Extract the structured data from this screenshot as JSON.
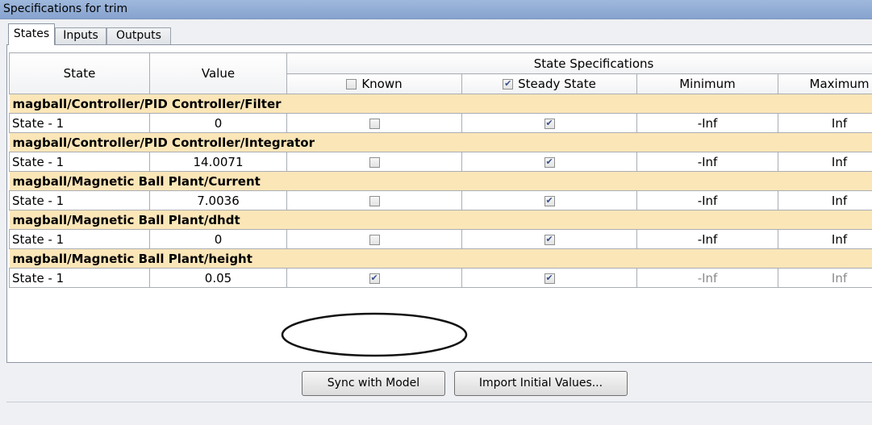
{
  "window": {
    "title": "Specifications for trim"
  },
  "tabs": [
    {
      "label": "States",
      "active": true
    },
    {
      "label": "Inputs",
      "active": false
    },
    {
      "label": "Outputs",
      "active": false
    }
  ],
  "table": {
    "col_state": "State",
    "col_value": "Value",
    "col_group": "State Specifications",
    "col_known": "Known",
    "col_steady": "Steady State",
    "col_min": "Minimum",
    "col_max": "Maximum",
    "header_known_checked": false,
    "header_steady_checked": true,
    "groups": [
      {
        "name": "magball/Controller/PID Controller/Filter",
        "row": {
          "state": "State - 1",
          "value": "0",
          "known": false,
          "steady": true,
          "min": "-Inf",
          "max": "Inf",
          "dimmed": false
        }
      },
      {
        "name": "magball/Controller/PID Controller/Integrator",
        "row": {
          "state": "State - 1",
          "value": "14.0071",
          "known": false,
          "steady": true,
          "min": "-Inf",
          "max": "Inf",
          "dimmed": false
        }
      },
      {
        "name": "magball/Magnetic Ball Plant/Current",
        "row": {
          "state": "State - 1",
          "value": "7.0036",
          "known": false,
          "steady": true,
          "min": "-Inf",
          "max": "Inf",
          "dimmed": false
        }
      },
      {
        "name": "magball/Magnetic Ball Plant/dhdt",
        "row": {
          "state": "State - 1",
          "value": "0",
          "known": false,
          "steady": true,
          "min": "-Inf",
          "max": "Inf",
          "dimmed": false
        }
      },
      {
        "name": "magball/Magnetic Ball Plant/height",
        "row": {
          "state": "State - 1",
          "value": "0.05",
          "known": true,
          "steady": true,
          "min": "-Inf",
          "max": "Inf",
          "dimmed": true
        }
      }
    ]
  },
  "buttons": {
    "sync": "Sync with Model",
    "import": "Import Initial Values..."
  },
  "colors": {
    "group_row_bg": "#fbe6b8",
    "titlebar_bg": "#9fb8dc"
  }
}
